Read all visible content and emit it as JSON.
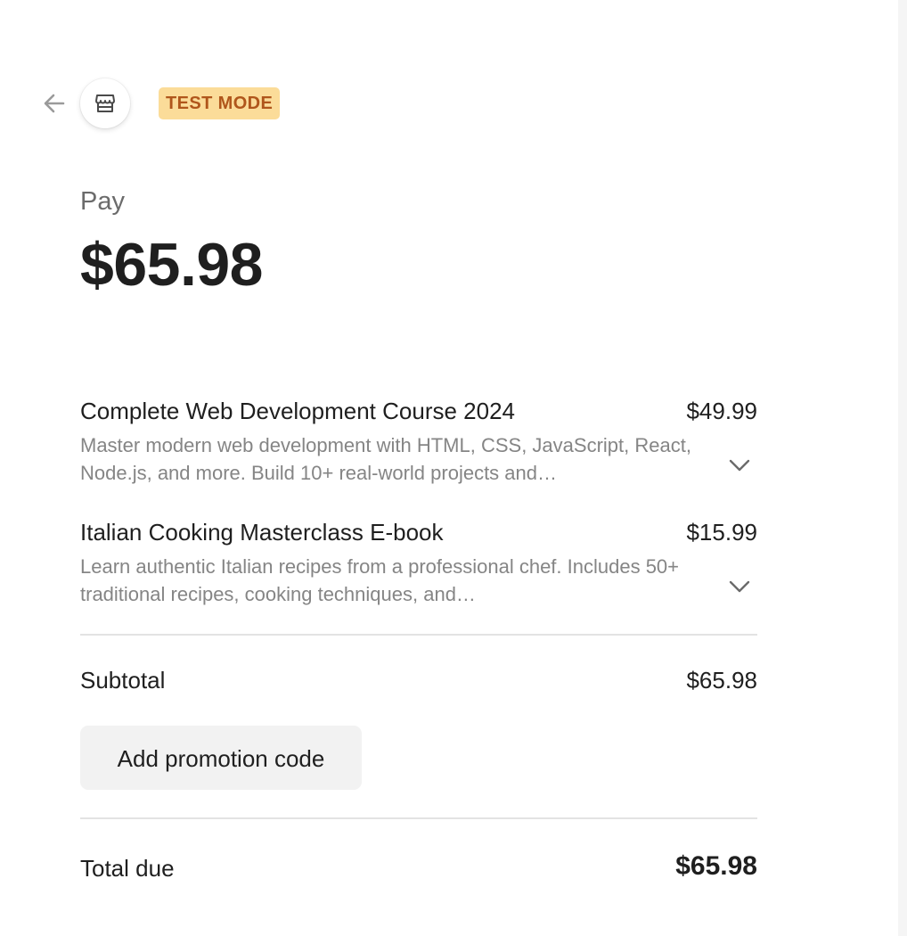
{
  "header": {
    "back_icon": "arrow-left-icon",
    "store_icon": "storefront-icon",
    "badge": "TEST MODE",
    "badge_color": "#fbdc99",
    "badge_text_color": "#b0561b"
  },
  "summary": {
    "pay_label": "Pay",
    "amount": "$65.98"
  },
  "line_items": [
    {
      "name": "Complete Web Development Course 2024",
      "price": "$49.99",
      "description": "Master modern web development with HTML, CSS, JavaScript, React, Node.js, and more. Build 10+ real-world projects and…",
      "expand_icon": "chevron-down-icon"
    },
    {
      "name": "Italian Cooking Masterclass E-book",
      "price": "$15.99",
      "description": "Learn authentic Italian recipes from a professional chef. Includes 50+ traditional recipes, cooking techniques, and…",
      "expand_icon": "chevron-down-icon"
    }
  ],
  "totals": {
    "subtotal_label": "Subtotal",
    "subtotal_value": "$65.98",
    "promo_label": "Add promotion code",
    "total_label": "Total due",
    "total_value": "$65.98"
  }
}
